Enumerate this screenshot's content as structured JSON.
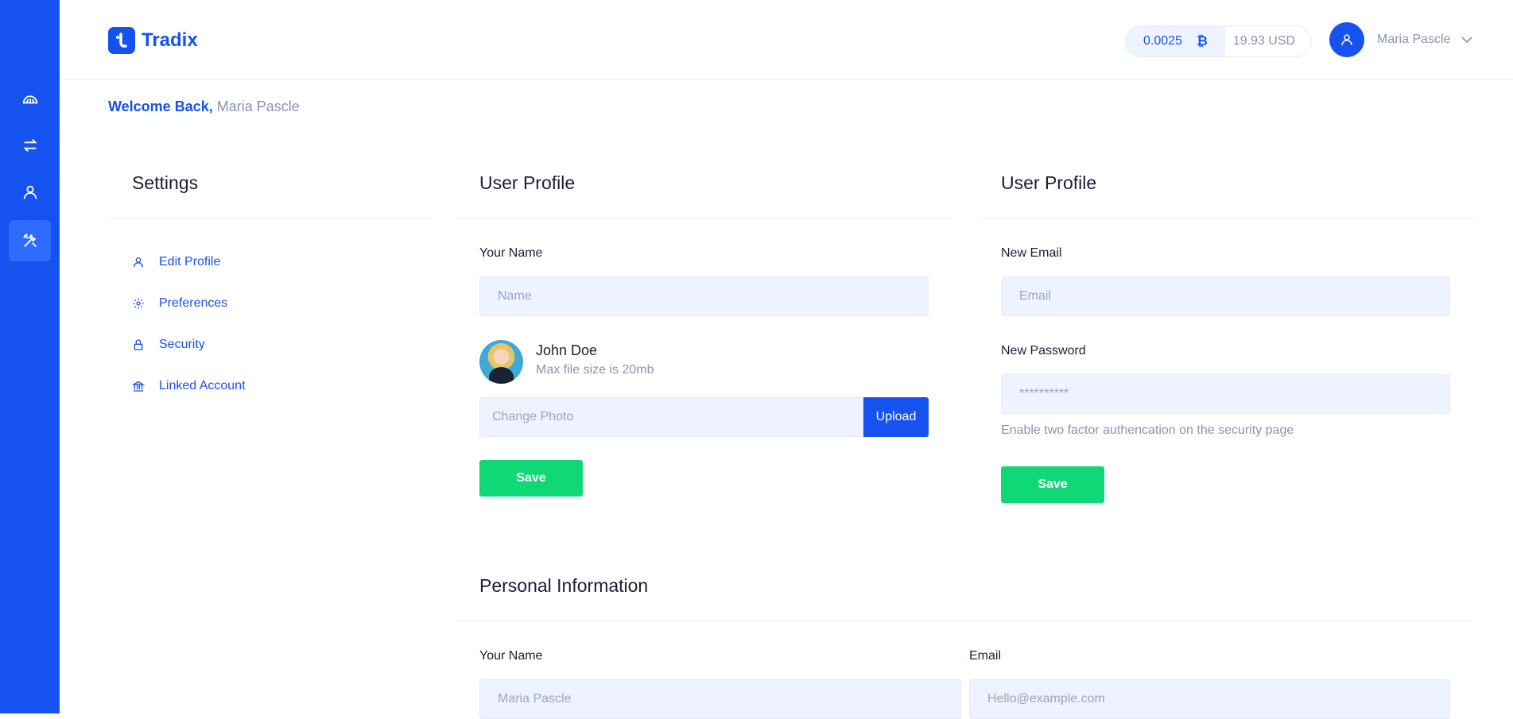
{
  "app": {
    "logo_name": "Tradix"
  },
  "header": {
    "btc_amount": "0.0025",
    "btc_symbol": "₿",
    "usd_amount": "19.93 USD",
    "user_name": "Maria Pascle"
  },
  "welcome": {
    "greeting": "Welcome Back,",
    "name": "Maria Pascle"
  },
  "sidebar": {
    "icons": [
      "dashboard-icon",
      "exchange-icon",
      "user-icon",
      "settings-tools-icon"
    ],
    "active_index": 3
  },
  "settings": {
    "title": "Settings",
    "items": [
      {
        "label": "Edit Profile",
        "icon": "user-icon"
      },
      {
        "label": "Preferences",
        "icon": "gear-icon"
      },
      {
        "label": "Security",
        "icon": "lock-icon"
      },
      {
        "label": "Linked Account",
        "icon": "bank-icon"
      }
    ]
  },
  "profile_card": {
    "title": "User Profile",
    "name_label": "Your Name",
    "name_placeholder": "Name",
    "photo_name": "John Doe",
    "photo_hint": "Max file size is 20mb",
    "photo_placeholder": "Change Photo",
    "upload_label": "Upload",
    "save_label": "Save"
  },
  "account_card": {
    "title": "User Profile",
    "email_label": "New Email",
    "email_placeholder": "Email",
    "password_label": "New Password",
    "password_placeholder": "**********",
    "hint": "Enable two factor authencation on the security page",
    "save_label": "Save"
  },
  "personal_info": {
    "title": "Personal Information",
    "name_label": "Your Name",
    "name_placeholder": "Maria Pascle",
    "email_label": "Email",
    "email_placeholder": "Hello@example.com"
  },
  "colors": {
    "primary": "#1652f0",
    "success": "#10d876",
    "field_bg": "#eef3ff",
    "muted": "#8a93b2"
  }
}
